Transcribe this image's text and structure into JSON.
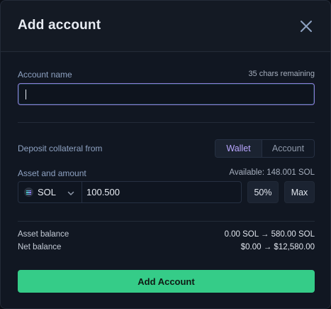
{
  "modal": {
    "title": "Add account",
    "close_icon": "close-icon"
  },
  "account_name": {
    "label": "Account name",
    "remaining": "35 chars remaining",
    "value": "",
    "focus_border_color": "#8b7bd6"
  },
  "deposit": {
    "label": "Deposit collateral from",
    "options": [
      "Wallet",
      "Account"
    ],
    "selected": "Wallet"
  },
  "asset": {
    "label": "Asset and amount",
    "available": "Available: 148.001 SOL",
    "selected_asset": "SOL",
    "asset_icon": "solana-icon",
    "amount": "100.500",
    "quick_percent": "50%",
    "quick_max": "Max"
  },
  "summary": {
    "asset_balance_label": "Asset balance",
    "asset_balance_value": "0.00 SOL → 580.00 SOL",
    "net_balance_label": "Net balance",
    "net_balance_value": "$0.00 → $12,580.00"
  },
  "submit": {
    "label": "Add Account",
    "color": "#35cc88"
  }
}
